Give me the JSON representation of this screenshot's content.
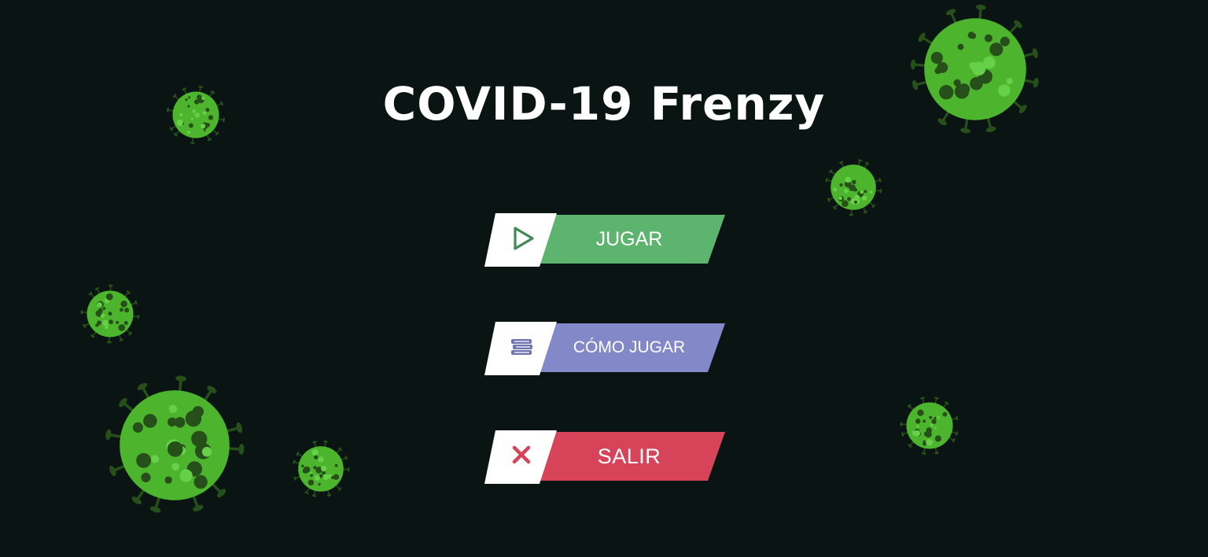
{
  "game": {
    "title": "COVID-19 Frenzy"
  },
  "menu": {
    "play": {
      "label": "JUGAR",
      "icon": "play-icon",
      "color": "#5db46e",
      "icon_color": "#3f8a55"
    },
    "how_to_play": {
      "label": "CÓMO JUGAR",
      "icon": "book-stack-icon",
      "color": "#8389c8",
      "icon_color": "#6e74b0"
    },
    "quit": {
      "label": "SALIR",
      "icon": "close-icon",
      "color": "#d74459",
      "icon_color": "#d74459"
    }
  },
  "palette": {
    "background": "#0a1413",
    "virus_body": "#4cb52d",
    "virus_spot_dark": "#264f1a",
    "virus_spot_light": "#66d048"
  }
}
